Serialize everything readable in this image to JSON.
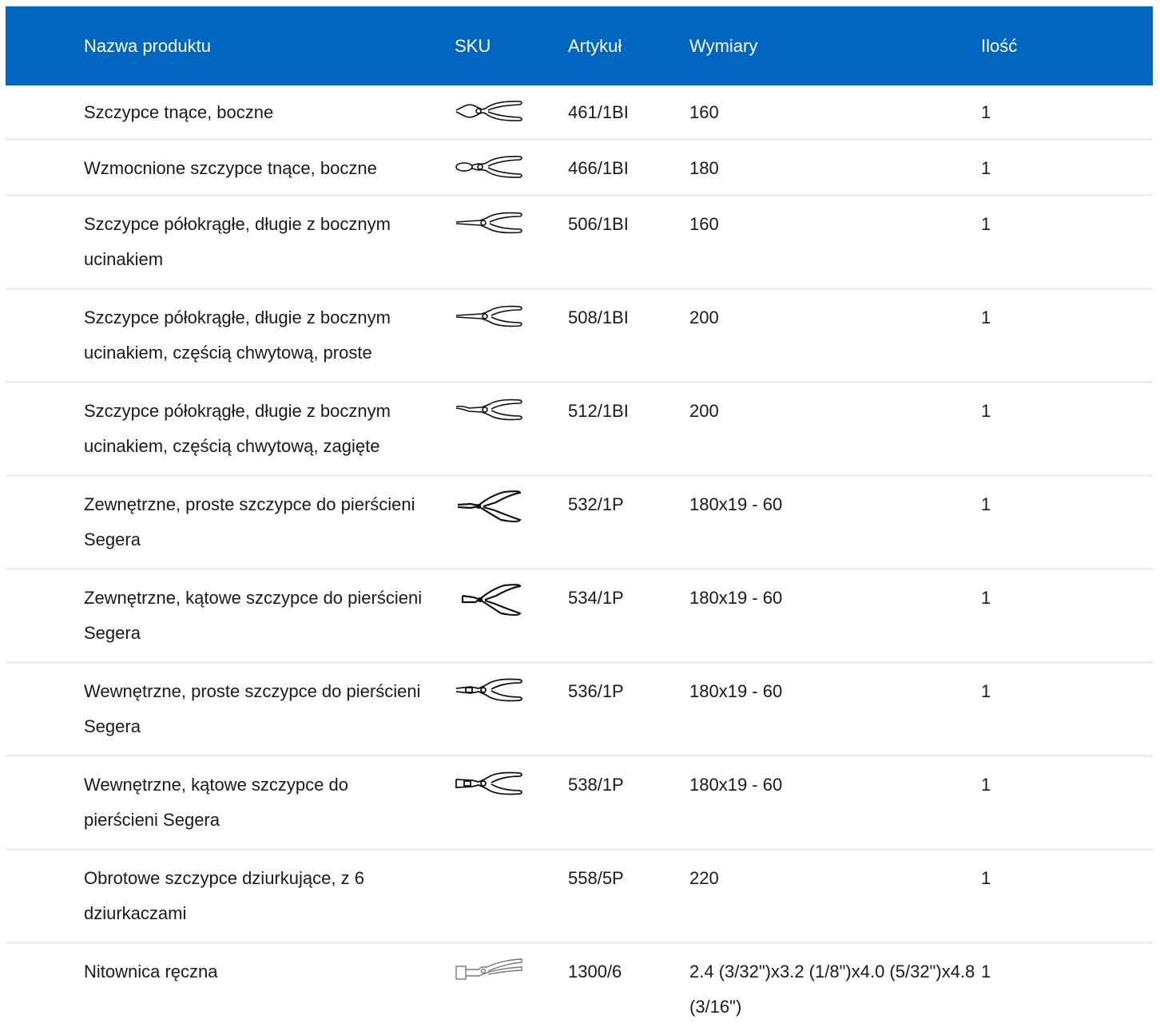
{
  "header": {
    "name": "Nazwa produktu",
    "sku": "SKU",
    "article": "Artykuł",
    "dimensions": "Wymiary",
    "quantity": "Ilość"
  },
  "rows": [
    {
      "name": "Szczypce tnące, boczne",
      "sku_icon": "diagonal-cutter-pliers-icon",
      "article": "461/1BI",
      "dimensions": "160",
      "quantity": "1"
    },
    {
      "name": "Wzmocnione szczypce tnące, boczne",
      "sku_icon": "heavy-duty-cutter-pliers-icon",
      "article": "466/1BI",
      "dimensions": "180",
      "quantity": "1"
    },
    {
      "name": "Szczypce półokrągłe, długie z bocznym ucinakiem",
      "sku_icon": "long-nose-pliers-icon",
      "article": "506/1BI",
      "dimensions": "160",
      "quantity": "1"
    },
    {
      "name": "Szczypce półokrągłe, długie z bocznym ucinakiem, częścią chwytową, proste",
      "sku_icon": "long-nose-pliers-icon",
      "article": "508/1BI",
      "dimensions": "200",
      "quantity": "1"
    },
    {
      "name": "Szczypce półokrągłe, długie z bocznym ucinakiem, częścią chwytową, zagięte",
      "sku_icon": "bent-nose-pliers-icon",
      "article": "512/1BI",
      "dimensions": "200",
      "quantity": "1"
    },
    {
      "name": "Zewnętrzne, proste szczypce do pierścieni Segera",
      "sku_icon": "circlip-pliers-icon",
      "article": "532/1P",
      "dimensions": "180x19 - 60",
      "quantity": "1"
    },
    {
      "name": "Zewnętrzne, kątowe szczypce do pierścieni Segera",
      "sku_icon": "angled-circlip-pliers-icon",
      "article": "534/1P",
      "dimensions": "180x19 - 60",
      "quantity": "1"
    },
    {
      "name": "Wewnętrzne, proste szczypce do pierścieni Segera",
      "sku_icon": "internal-circlip-pliers-icon",
      "article": "536/1P",
      "dimensions": "180x19 - 60",
      "quantity": "1"
    },
    {
      "name": "Wewnętrzne, kątowe szczypce do pierścieni Segera",
      "sku_icon": "internal-angled-circlip-pliers-icon",
      "article": "538/1P",
      "dimensions": "180x19 - 60",
      "quantity": "1"
    },
    {
      "name": "Obrotowe szczypce dziurkujące, z 6 dziurkaczami",
      "sku_icon": "",
      "article": "558/5P",
      "dimensions": "220",
      "quantity": "1"
    },
    {
      "name": "Nitownica ręczna",
      "sku_icon": "hand-riveter-icon",
      "article": "1300/6",
      "dimensions": "2.4 (3/32\")x3.2 (1/8\")x4.0 (5/32\")x4.8 (3/16\")",
      "quantity": "1"
    }
  ]
}
